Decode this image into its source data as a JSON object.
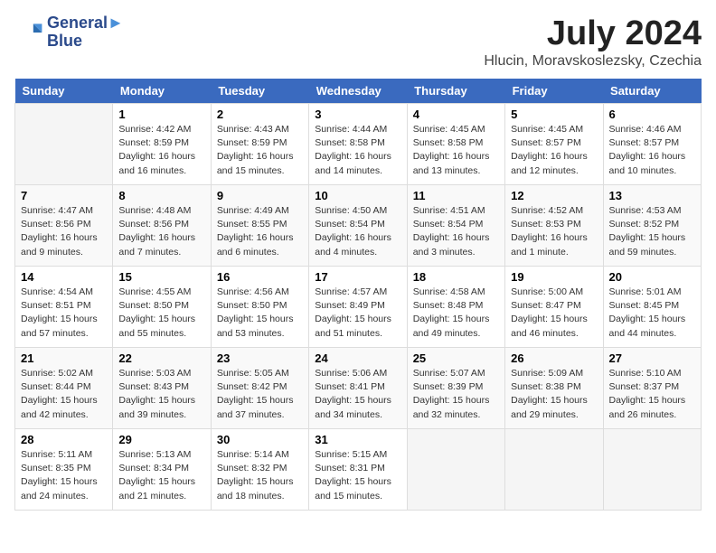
{
  "header": {
    "logo_line1": "General",
    "logo_line2": "Blue",
    "month": "July 2024",
    "location": "Hlucin, Moravskoslezsky, Czechia"
  },
  "weekdays": [
    "Sunday",
    "Monday",
    "Tuesday",
    "Wednesday",
    "Thursday",
    "Friday",
    "Saturday"
  ],
  "weeks": [
    [
      {
        "day": "",
        "info": ""
      },
      {
        "day": "1",
        "info": "Sunrise: 4:42 AM\nSunset: 8:59 PM\nDaylight: 16 hours\nand 16 minutes."
      },
      {
        "day": "2",
        "info": "Sunrise: 4:43 AM\nSunset: 8:59 PM\nDaylight: 16 hours\nand 15 minutes."
      },
      {
        "day": "3",
        "info": "Sunrise: 4:44 AM\nSunset: 8:58 PM\nDaylight: 16 hours\nand 14 minutes."
      },
      {
        "day": "4",
        "info": "Sunrise: 4:45 AM\nSunset: 8:58 PM\nDaylight: 16 hours\nand 13 minutes."
      },
      {
        "day": "5",
        "info": "Sunrise: 4:45 AM\nSunset: 8:57 PM\nDaylight: 16 hours\nand 12 minutes."
      },
      {
        "day": "6",
        "info": "Sunrise: 4:46 AM\nSunset: 8:57 PM\nDaylight: 16 hours\nand 10 minutes."
      }
    ],
    [
      {
        "day": "7",
        "info": "Sunrise: 4:47 AM\nSunset: 8:56 PM\nDaylight: 16 hours\nand 9 minutes."
      },
      {
        "day": "8",
        "info": "Sunrise: 4:48 AM\nSunset: 8:56 PM\nDaylight: 16 hours\nand 7 minutes."
      },
      {
        "day": "9",
        "info": "Sunrise: 4:49 AM\nSunset: 8:55 PM\nDaylight: 16 hours\nand 6 minutes."
      },
      {
        "day": "10",
        "info": "Sunrise: 4:50 AM\nSunset: 8:54 PM\nDaylight: 16 hours\nand 4 minutes."
      },
      {
        "day": "11",
        "info": "Sunrise: 4:51 AM\nSunset: 8:54 PM\nDaylight: 16 hours\nand 3 minutes."
      },
      {
        "day": "12",
        "info": "Sunrise: 4:52 AM\nSunset: 8:53 PM\nDaylight: 16 hours\nand 1 minute."
      },
      {
        "day": "13",
        "info": "Sunrise: 4:53 AM\nSunset: 8:52 PM\nDaylight: 15 hours\nand 59 minutes."
      }
    ],
    [
      {
        "day": "14",
        "info": "Sunrise: 4:54 AM\nSunset: 8:51 PM\nDaylight: 15 hours\nand 57 minutes."
      },
      {
        "day": "15",
        "info": "Sunrise: 4:55 AM\nSunset: 8:50 PM\nDaylight: 15 hours\nand 55 minutes."
      },
      {
        "day": "16",
        "info": "Sunrise: 4:56 AM\nSunset: 8:50 PM\nDaylight: 15 hours\nand 53 minutes."
      },
      {
        "day": "17",
        "info": "Sunrise: 4:57 AM\nSunset: 8:49 PM\nDaylight: 15 hours\nand 51 minutes."
      },
      {
        "day": "18",
        "info": "Sunrise: 4:58 AM\nSunset: 8:48 PM\nDaylight: 15 hours\nand 49 minutes."
      },
      {
        "day": "19",
        "info": "Sunrise: 5:00 AM\nSunset: 8:47 PM\nDaylight: 15 hours\nand 46 minutes."
      },
      {
        "day": "20",
        "info": "Sunrise: 5:01 AM\nSunset: 8:45 PM\nDaylight: 15 hours\nand 44 minutes."
      }
    ],
    [
      {
        "day": "21",
        "info": "Sunrise: 5:02 AM\nSunset: 8:44 PM\nDaylight: 15 hours\nand 42 minutes."
      },
      {
        "day": "22",
        "info": "Sunrise: 5:03 AM\nSunset: 8:43 PM\nDaylight: 15 hours\nand 39 minutes."
      },
      {
        "day": "23",
        "info": "Sunrise: 5:05 AM\nSunset: 8:42 PM\nDaylight: 15 hours\nand 37 minutes."
      },
      {
        "day": "24",
        "info": "Sunrise: 5:06 AM\nSunset: 8:41 PM\nDaylight: 15 hours\nand 34 minutes."
      },
      {
        "day": "25",
        "info": "Sunrise: 5:07 AM\nSunset: 8:39 PM\nDaylight: 15 hours\nand 32 minutes."
      },
      {
        "day": "26",
        "info": "Sunrise: 5:09 AM\nSunset: 8:38 PM\nDaylight: 15 hours\nand 29 minutes."
      },
      {
        "day": "27",
        "info": "Sunrise: 5:10 AM\nSunset: 8:37 PM\nDaylight: 15 hours\nand 26 minutes."
      }
    ],
    [
      {
        "day": "28",
        "info": "Sunrise: 5:11 AM\nSunset: 8:35 PM\nDaylight: 15 hours\nand 24 minutes."
      },
      {
        "day": "29",
        "info": "Sunrise: 5:13 AM\nSunset: 8:34 PM\nDaylight: 15 hours\nand 21 minutes."
      },
      {
        "day": "30",
        "info": "Sunrise: 5:14 AM\nSunset: 8:32 PM\nDaylight: 15 hours\nand 18 minutes."
      },
      {
        "day": "31",
        "info": "Sunrise: 5:15 AM\nSunset: 8:31 PM\nDaylight: 15 hours\nand 15 minutes."
      },
      {
        "day": "",
        "info": ""
      },
      {
        "day": "",
        "info": ""
      },
      {
        "day": "",
        "info": ""
      }
    ]
  ]
}
